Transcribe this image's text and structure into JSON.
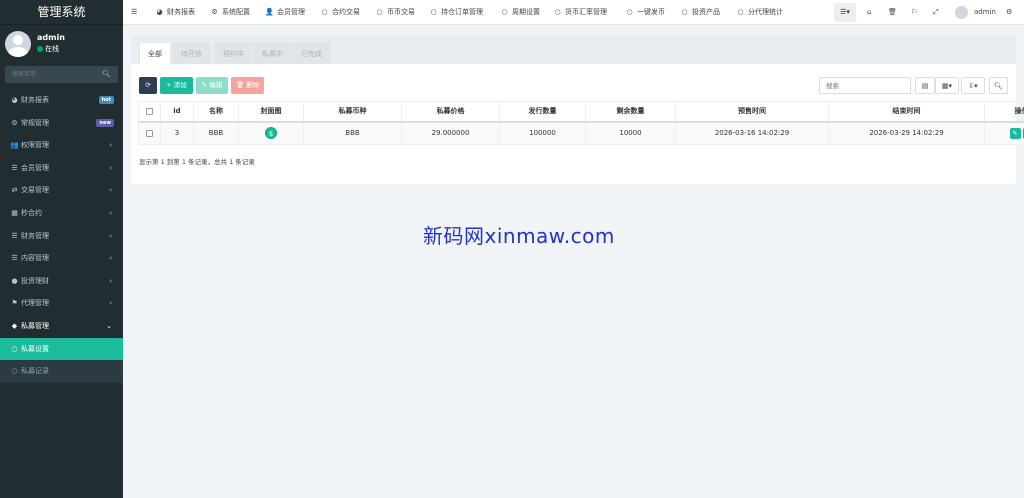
{
  "sidebar": {
    "brand": "管理系统",
    "user": {
      "name": "admin",
      "status": "在线"
    },
    "search_placeholder": "搜索菜单",
    "menu": [
      {
        "icon": "dashboard-icon",
        "glyph": "◕",
        "label": "财务报表",
        "badge": "hot"
      },
      {
        "icon": "cogs-icon",
        "glyph": "⚙",
        "label": "常规管理",
        "badge": "new"
      },
      {
        "icon": "group-icon",
        "glyph": "👥",
        "label": "权限管理"
      },
      {
        "icon": "list-icon",
        "glyph": "☰",
        "label": "会员管理"
      },
      {
        "icon": "handshake-icon",
        "glyph": "⇄",
        "label": "交易管理"
      },
      {
        "icon": "calendar-icon",
        "glyph": "▦",
        "label": "秒合约"
      },
      {
        "icon": "list-icon",
        "glyph": "☰",
        "label": "财务管理"
      },
      {
        "icon": "list-icon",
        "glyph": "☰",
        "label": "内容管理"
      },
      {
        "icon": "coin-icon",
        "glyph": "●",
        "label": "投资理财"
      },
      {
        "icon": "tag-icon",
        "glyph": "⚑",
        "label": "代理管理"
      },
      {
        "icon": "diamond-icon",
        "glyph": "◆",
        "label": "私募管理"
      },
      {
        "icon": "circle-icon",
        "glyph": "○",
        "label": "私募设置"
      },
      {
        "icon": "circle-icon",
        "glyph": "○",
        "label": "私募记录"
      }
    ]
  },
  "topnav": {
    "items": [
      {
        "glyph": "◕",
        "label": "财务报表"
      },
      {
        "glyph": "⚙",
        "label": "系统配置"
      },
      {
        "glyph": "👤",
        "label": "会员管理"
      },
      {
        "glyph": "○",
        "label": "合约交易"
      },
      {
        "glyph": "○",
        "label": "币币交易"
      },
      {
        "glyph": "○",
        "label": "持仓订单管理"
      },
      {
        "glyph": "○",
        "label": "周期设置"
      },
      {
        "glyph": "○",
        "label": "货币汇率管理"
      },
      {
        "glyph": "○",
        "label": "一键发币"
      },
      {
        "glyph": "○",
        "label": "投资产品"
      },
      {
        "glyph": "○",
        "label": "分代理统计"
      }
    ],
    "user": "admin"
  },
  "tabs": [
    "全部",
    "待开放",
    "预约中",
    "私募中",
    "已完成"
  ],
  "toolbar": {
    "add": "添加",
    "edit": "编辑",
    "del": "删除",
    "search_placeholder": "搜索"
  },
  "table": {
    "headers": [
      "id",
      "名称",
      "封面图",
      "私募币种",
      "私募价格",
      "发行数量",
      "剩余数量",
      "预售时间",
      "结束时间",
      "操作"
    ],
    "rows": [
      {
        "id": "3",
        "name": "BBB",
        "coin": "BBB",
        "price": "29.000000",
        "issue": "100000",
        "remain": "10000",
        "presale": "2026-03-16 14:02:29",
        "end": "2026-03-29 14:02:29"
      }
    ]
  },
  "pagination": {
    "info": "显示第 1 到第 1 条记录，总共 1 条记录"
  },
  "watermark": "新码网xinmaw.com",
  "colors": {
    "sidebar": "#222d32",
    "accent": "#1abc9c",
    "edit": "#1abc9c",
    "delete": "#e74c3c",
    "watermark": "#2333c9"
  }
}
